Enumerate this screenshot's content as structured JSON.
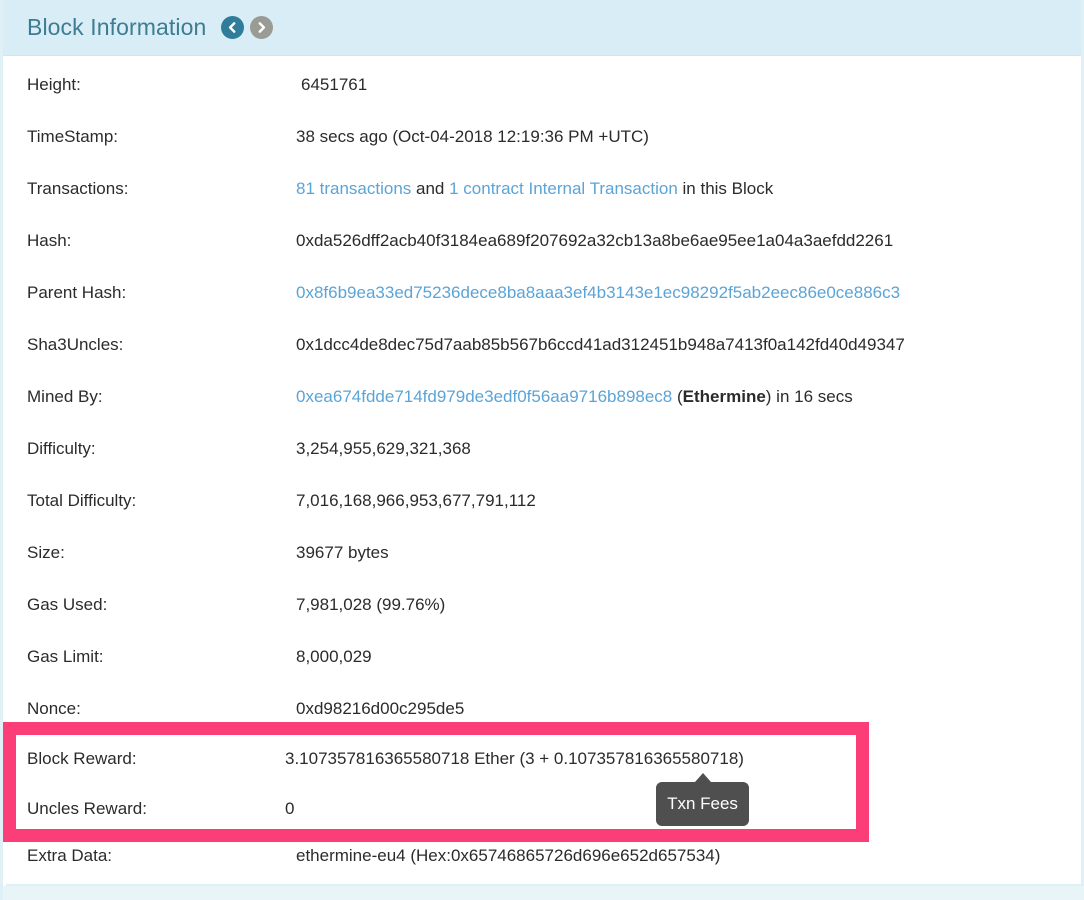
{
  "header": {
    "title": "Block Information",
    "prev_icon": "chevron-left-circle-icon",
    "next_icon": "chevron-right-circle-icon",
    "bg_color": "#d9edf7",
    "title_color": "#3d7c91",
    "prev_color": "#2f7d9b",
    "next_color": "#9b9b95"
  },
  "rows": {
    "height": {
      "label": "Height:",
      "value": "6451761"
    },
    "timestamp": {
      "label": "TimeStamp:",
      "value": "38 secs ago (Oct-04-2018 12:19:36 PM +UTC)"
    },
    "transactions": {
      "label": "Transactions:",
      "link1": "81 transactions",
      "mid": " and ",
      "link2": "1 contract Internal Transaction",
      "tail": " in this Block"
    },
    "hash": {
      "label": "Hash:",
      "value": "0xda526dff2acb40f3184ea689f207692a32cb13a8be6ae95ee1a04a3aefdd2261"
    },
    "parent_hash": {
      "label": "Parent Hash:",
      "value": "0x8f6b9ea33ed75236dece8ba8aaa3ef4b3143e1ec98292f5ab2eec86e0ce886c3"
    },
    "sha3_uncles": {
      "label": "Sha3Uncles:",
      "value": "0x1dcc4de8dec75d7aab85b567b6ccd41ad312451b948a7413f0a142fd40d49347"
    },
    "mined_by": {
      "label": "Mined By:",
      "address": "0xea674fdde714fd979de3edf0f56aa9716b898ec8",
      "open_paren": " (",
      "pool": "Ethermine",
      "close": ") in 16 secs"
    },
    "difficulty": {
      "label": "Difficulty:",
      "value": "3,254,955,629,321,368"
    },
    "total_difficulty": {
      "label": "Total Difficulty:",
      "value": "7,016,168,966,953,677,791,112"
    },
    "size": {
      "label": "Size:",
      "value": "39677 bytes"
    },
    "gas_used": {
      "label": "Gas Used:",
      "value": "7,981,028 (99.76%)"
    },
    "gas_limit": {
      "label": "Gas Limit:",
      "value": "8,000,029"
    },
    "nonce": {
      "label": "Nonce:",
      "value": "0xd98216d00c295de5"
    },
    "block_reward": {
      "label": "Block Reward:",
      "value": "3.107357816365580718 Ether (3 + 0.107357816365580718)"
    },
    "uncles_reward": {
      "label": "Uncles Reward:",
      "value": "0"
    },
    "extra_data": {
      "label": "Extra Data:",
      "value": "ethermine-eu4 (Hex:0x65746865726d696e652d657534)"
    }
  },
  "tooltip": {
    "text": "Txn Fees",
    "bg_color": "#4f4f4f"
  },
  "highlight": {
    "border_color": "#fb3e77"
  },
  "colors": {
    "link": "#5ba4d6",
    "text": "#2b2b2b"
  }
}
